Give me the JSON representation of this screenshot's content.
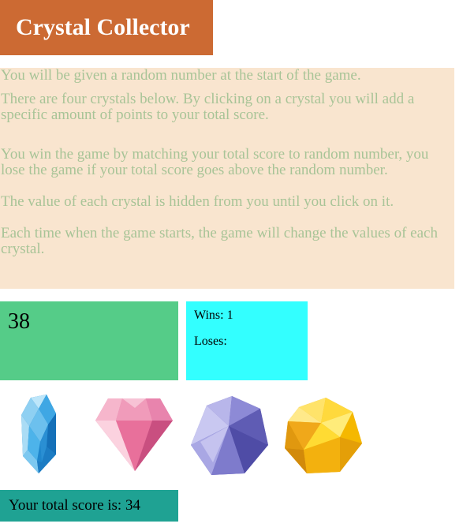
{
  "header": {
    "title": "Crystal Collector"
  },
  "instructions": [
    "You will be given a random number at the start of the game.",
    "There are four crystals below. By clicking on a crystal you will add a specific amount of points to your total score.",
    "You win the game by matching your total score to random number, you lose the game if your total score goes above the random number.",
    "The value of each crystal is hidden from you until you click on it.",
    "Each time when the game starts, the game will change the values of each crystal."
  ],
  "target_number": "38",
  "stats": {
    "wins": "Wins: 1",
    "loses": "Loses:"
  },
  "crystals": [
    {
      "name": "blue-crystal-icon",
      "color": "#2a9ad8"
    },
    {
      "name": "pink-diamond-icon",
      "color": "#e87aa2"
    },
    {
      "name": "purple-crystal-icon",
      "color": "#7b78c8"
    },
    {
      "name": "yellow-crystal-icon",
      "color": "#f7c41c"
    }
  ],
  "score": {
    "label": "Your total score is: 34"
  },
  "colors": {
    "title_bg": "#cc6a33",
    "instructions_bg": "#f9e5cf",
    "instructions_text": "#a8c497",
    "target_bg": "#55cc88",
    "stats_bg": "#33ffff",
    "score_bg": "#1fa293"
  }
}
